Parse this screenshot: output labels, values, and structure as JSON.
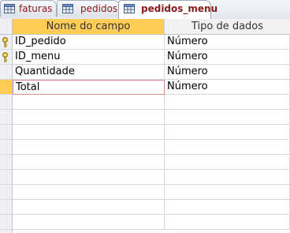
{
  "tabs": [
    {
      "label": "faturas",
      "active": false
    },
    {
      "label": "pedidos",
      "active": false
    },
    {
      "label": "pedidos_menu",
      "active": true
    }
  ],
  "table": {
    "columns": [
      "Nome do campo",
      "Tipo de dados"
    ],
    "rows": [
      {
        "field": "ID_pedido",
        "type": "Número",
        "primary_key": true
      },
      {
        "field": "ID_menu",
        "type": "Número",
        "primary_key": true
      },
      {
        "field": "Quantidade",
        "type": "Número",
        "primary_key": false
      },
      {
        "field": "Total",
        "type": "Número",
        "primary_key": false,
        "current": true
      }
    ]
  },
  "colors": {
    "header_highlight": "#ffcc55",
    "tab_text": "#8b1a1a",
    "edit_border": "#e48b8b"
  }
}
